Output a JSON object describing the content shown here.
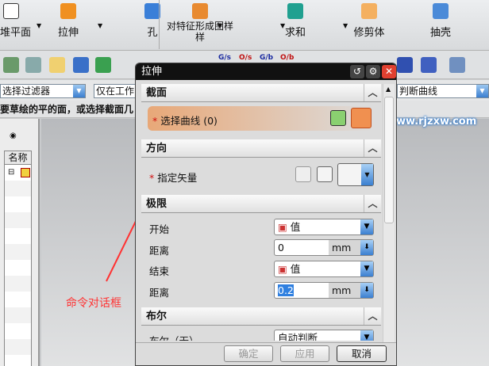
{
  "toolbar": {
    "items": [
      {
        "label": "堆平面"
      },
      {
        "label": "拉伸"
      },
      {
        "label": "孔"
      },
      {
        "label": "对特征形成图样",
        "label2": "样"
      },
      {
        "label": "求和"
      },
      {
        "label": "修剪体"
      },
      {
        "label": "抽壳"
      }
    ],
    "snap_labels": [
      "G/s",
      "O/s",
      "G/b",
      "O/b"
    ]
  },
  "filter": {
    "type_filter": "选择过滤器",
    "scope": "仅在工作",
    "curve_rule": "判断曲线"
  },
  "cue": "要草绘的平的面，或选择截面几",
  "navigator": {
    "column": "名称"
  },
  "annotation": "命令对话框",
  "watermark": "www.rjzxw.com",
  "dialog": {
    "title": "拉伸",
    "section": {
      "header": "截面",
      "select_curve": "选择曲线 (0)"
    },
    "direction": {
      "header": "方向",
      "specify_vector": "指定矢量"
    },
    "limits": {
      "header": "极限",
      "start_label": "开始",
      "start_value": "值",
      "start_dist_label": "距离",
      "start_dist": "0",
      "unit": "mm",
      "end_label": "结束",
      "end_value": "值",
      "end_dist_label": "距离",
      "end_dist": "0.2"
    },
    "boolean": {
      "header": "布尔",
      "label": "布尔（无）",
      "value": "自动判断"
    },
    "buttons": {
      "ok": "确定",
      "apply": "应用",
      "cancel": "取消"
    }
  },
  "colors": {
    "title_bar": "#111111",
    "close": "#e04030",
    "highlight": "#e8a878",
    "annotation": "#ff3333"
  }
}
